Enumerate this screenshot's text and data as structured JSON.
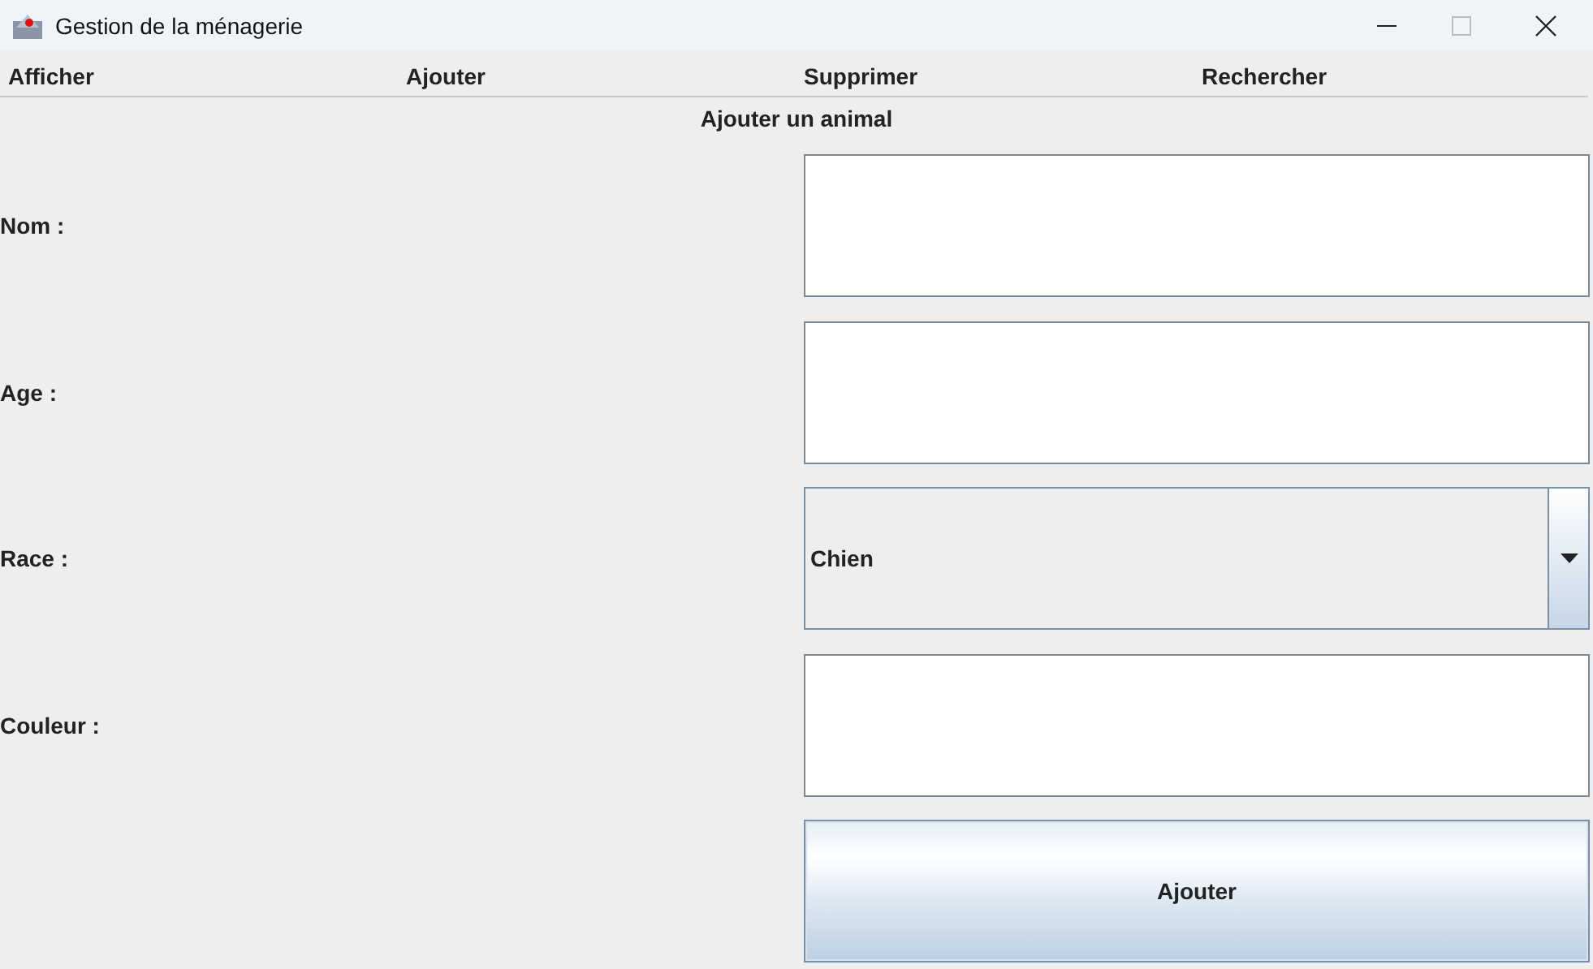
{
  "window": {
    "title": "Gestion de la ménagerie"
  },
  "menu": [
    "Afficher",
    "Ajouter",
    "Supprimer",
    "Rechercher"
  ],
  "form": {
    "title": "Ajouter un animal",
    "fields": [
      {
        "label": "Nom :",
        "kind": "text"
      },
      {
        "label": "Age :",
        "kind": "text"
      },
      {
        "label": "Race :",
        "kind": "select",
        "value": "Chien"
      },
      {
        "label": "Couleur :",
        "kind": "text"
      }
    ],
    "button": "Ajouter"
  }
}
